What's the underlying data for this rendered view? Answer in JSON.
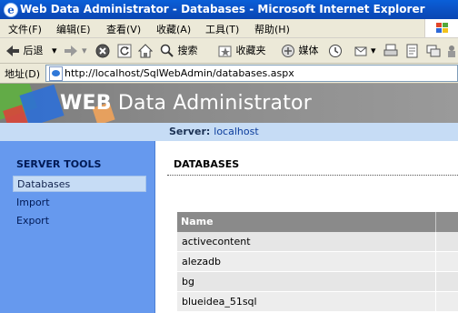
{
  "window": {
    "title": "Web Data Administrator - Databases - Microsoft Internet Explorer"
  },
  "menubar": {
    "items": [
      "文件(F)",
      "编辑(E)",
      "查看(V)",
      "收藏(A)",
      "工具(T)",
      "帮助(H)"
    ]
  },
  "toolbar": {
    "back_label": "后退",
    "search_label": "搜索",
    "favorites_label": "收藏夹",
    "media_label": "媒体"
  },
  "addressbar": {
    "label": "地址(D)",
    "url": "http://localhost/SqlWebAdmin/databases.aspx"
  },
  "banner": {
    "title_bold": "WEB",
    "title_rest": " Data Administrator"
  },
  "server": {
    "label": "Server:",
    "value": "localhost"
  },
  "sidebar": {
    "heading": "SERVER TOOLS",
    "items": [
      {
        "label": "Databases",
        "active": true
      },
      {
        "label": "Import",
        "active": false
      },
      {
        "label": "Export",
        "active": false
      }
    ]
  },
  "main": {
    "heading": "DATABASES",
    "table": {
      "header": "Name",
      "rows": [
        "activecontent",
        "alezadb",
        "bg",
        "blueidea_51sql"
      ]
    }
  },
  "colors": {
    "titlebar": "#0b54c8",
    "sidebar": "#6699ee",
    "serverbar": "#c6dcf5",
    "table_header": "#8a8a8a"
  }
}
